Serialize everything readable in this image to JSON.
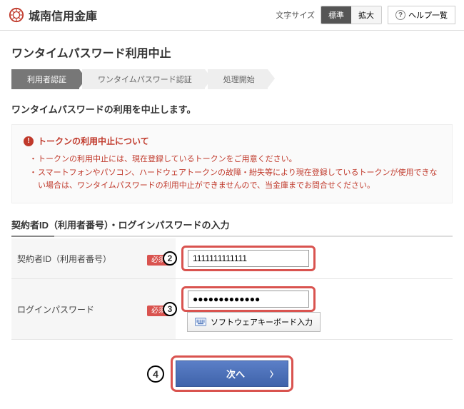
{
  "header": {
    "logo_text": "城南信用金庫",
    "font_size_label": "文字サイズ",
    "btn_standard": "標準",
    "btn_large": "拡大",
    "help_label": "ヘルプ一覧"
  },
  "page": {
    "title": "ワンタイムパスワード利用中止",
    "steps": [
      "利用者認証",
      "ワンタイムパスワード認証",
      "処理開始"
    ],
    "active_step": 0,
    "subhead": "ワンタイムパスワードの利用を中止します。"
  },
  "notice": {
    "title": "トークンの利用中止について",
    "items": [
      "トークンの利用中止には、現在登録しているトークンをご用意ください。",
      "スマートフォンやパソコン、ハードウェアトークンの故障・紛失等により現在登録しているトークンが使用できない場合は、ワンタイムパスワードの利用中止ができませんので、当金庫までお問合せください。"
    ]
  },
  "form": {
    "section_title": "契約者ID（利用者番号）・ログインパスワードの入力",
    "required_label": "必須",
    "rows": [
      {
        "label": "契約者ID（利用者番号）",
        "value": "1111111111111",
        "callout": "2"
      },
      {
        "label": "ログインパスワード",
        "value": "●●●●●●●●●●●●●",
        "callout": "3"
      }
    ],
    "swkb_label": "ソフトウェアキーボード入力",
    "submit_label": "次へ",
    "submit_callout": "4"
  }
}
